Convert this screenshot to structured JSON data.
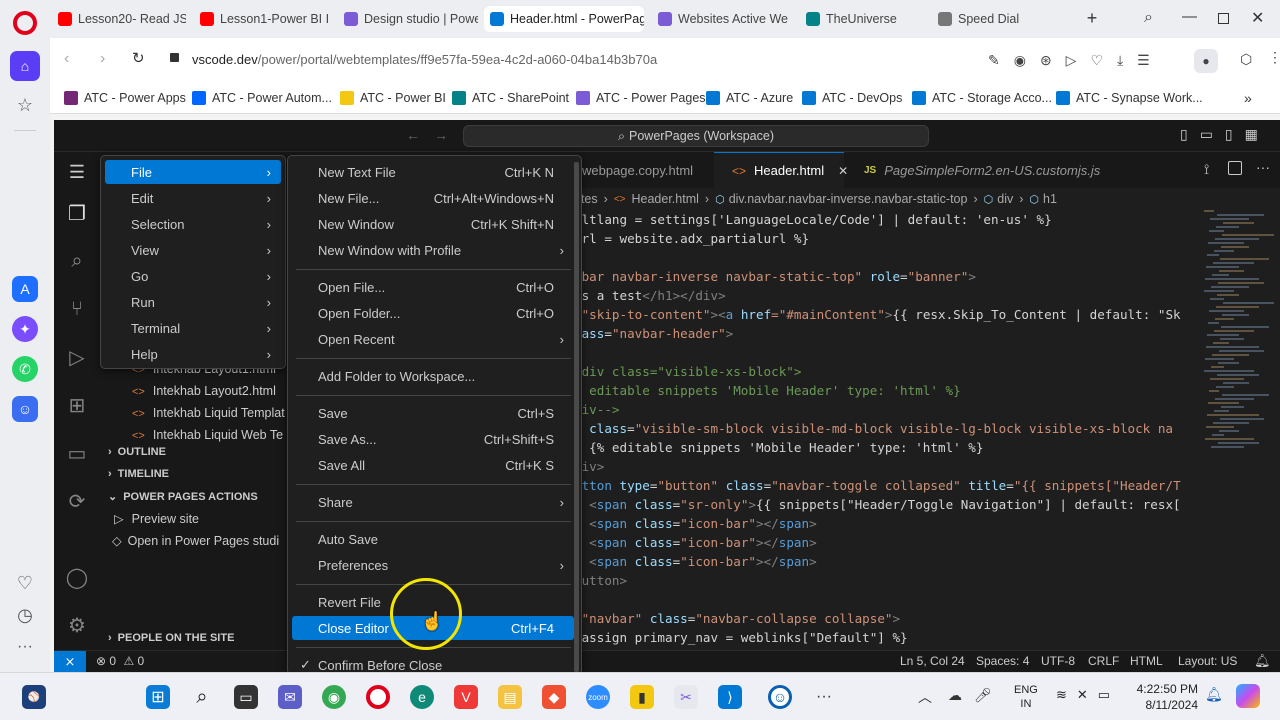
{
  "browser": {
    "tabs": [
      {
        "label": "Lesson20- Read JSO",
        "icon": "youtube-icon",
        "color": "#ff0000"
      },
      {
        "label": "Lesson1-Power BI In",
        "icon": "youtube-icon",
        "color": "#ff0000"
      },
      {
        "label": "Design studio | Powe",
        "icon": "power-pages-icon",
        "color": "#7b5cd6"
      },
      {
        "label": "Header.html - PowerPage",
        "icon": "vscode-icon",
        "color": "#0078d4"
      },
      {
        "label": "Websites Active We",
        "icon": "power-pages-icon",
        "color": "#7b5cd6"
      },
      {
        "label": "TheUniverse",
        "icon": "sharepoint-icon",
        "color": "#038387"
      },
      {
        "label": "Speed Dial",
        "icon": "grid-icon",
        "color": "#777777"
      }
    ],
    "url_prefix": "vscode.dev",
    "url_path": "/power/portal/webtemplates/ff9e57fa-59ea-4c2d-a060-04ba14b3b70a",
    "bookmarks": [
      {
        "label": "ATC - Power Apps",
        "color": "#742774"
      },
      {
        "label": "ATC - Power Autom...",
        "color": "#0066ff"
      },
      {
        "label": "ATC - Power BI",
        "color": "#f2c811"
      },
      {
        "label": "ATC - SharePoint",
        "color": "#038387"
      },
      {
        "label": "ATC - Power Pages",
        "color": "#7b5cd6"
      },
      {
        "label": "ATC - Azure",
        "color": "#0078d4"
      },
      {
        "label": "ATC - DevOps",
        "color": "#0078d4"
      },
      {
        "label": "ATC - Storage Acco...",
        "color": "#0078d4"
      },
      {
        "label": "ATC - Synapse Work...",
        "color": "#0078d4"
      }
    ]
  },
  "vscode": {
    "command_center": "PowerPages (Workspace)",
    "editor_tabs": [
      {
        "label": "webpage.copy.html",
        "active": false
      },
      {
        "label": "Header.html",
        "active": true,
        "close": "✕"
      },
      {
        "label": "PageSimpleForm2.en-US.customjs.js",
        "active": false,
        "prefix": "JS"
      }
    ],
    "breadcrumb": [
      "ates",
      "Header.html",
      "div.navbar.navbar-inverse.navbar-static-top",
      "div",
      "h1"
    ],
    "explorer_files": [
      "Intekhab Layout1.html",
      "Intekhab Layout2.html",
      "Intekhab Liquid Templat",
      "Intekhab Liquid Web Te"
    ],
    "sections": {
      "outline": "OUTLINE",
      "timeline": "TIMELINE",
      "power_pages_actions": "POWER PAGES ACTIONS",
      "preview_site": "Preview site",
      "open_in_power_pages": "Open in Power Pages studi",
      "people_on_site": "PEOPLE ON THE SITE"
    },
    "code_lines": [
      [
        [
          "ultlang = settings['LanguageLocale/Code'] | default: 'en-us' %}",
          "#d4d4d4"
        ]
      ],
      [
        [
          "url = website.adx_partialurl %}",
          "#d4d4d4"
        ]
      ],
      [
        [
          "",
          "#d4d4d4"
        ]
      ],
      [
        [
          "vbar navbar-inverse navbar-static-top\"",
          "#ce9178"
        ],
        [
          " role",
          "#9cdcfe"
        ],
        [
          "=",
          "#d4d4d4"
        ],
        [
          "\"banner\"",
          "#ce9178"
        ],
        [
          ">",
          "#808080"
        ]
      ],
      [
        [
          "is a test",
          "#d4d4d4"
        ],
        [
          "</h1></div>",
          "#808080"
        ]
      ],
      [
        [
          "=\"skip-to-content\"",
          "#ce9178"
        ],
        [
          "><",
          "#808080"
        ],
        [
          "a",
          "#569cd6"
        ],
        [
          " href",
          "#9cdcfe"
        ],
        [
          "=\"#mainContent\"",
          "#ce9178"
        ],
        [
          ">",
          "#808080"
        ],
        [
          "{{ resx.Skip_To_Content | default: \"Sk",
          "#d4d4d4"
        ]
      ],
      [
        [
          "lass",
          "#9cdcfe"
        ],
        [
          "=",
          "#d4d4d4"
        ],
        [
          "\"navbar-header\"",
          "#ce9178"
        ],
        [
          ">",
          "#808080"
        ]
      ],
      [
        [
          "",
          "#d4d4d4"
        ]
      ],
      [
        [
          "-div class=\"visible-xs-block\">",
          "#6a9955"
        ]
      ],
      [
        [
          "% editable snippets 'Mobile Header' type: 'html' %}",
          "#6a9955"
        ]
      ],
      [
        [
          "div-->",
          "#6a9955"
        ]
      ],
      [
        [
          "v",
          "#569cd6"
        ],
        [
          " class",
          "#9cdcfe"
        ],
        [
          "=",
          "#d4d4d4"
        ],
        [
          "\"visible-sm-block visible-md-block visible-lg-block visible-xs-block na",
          "#ce9178"
        ]
      ],
      [
        [
          "  {% editable snippets 'Mobile Header' type: 'html' %}",
          "#d4d4d4"
        ]
      ],
      [
        [
          "div>",
          "#808080"
        ]
      ],
      [
        [
          "utton",
          "#569cd6"
        ],
        [
          " type",
          "#9cdcfe"
        ],
        [
          "=",
          "#d4d4d4"
        ],
        [
          "\"button\"",
          "#ce9178"
        ],
        [
          " class",
          "#9cdcfe"
        ],
        [
          "=",
          "#d4d4d4"
        ],
        [
          "\"navbar-toggle collapsed\"",
          "#ce9178"
        ],
        [
          " title",
          "#9cdcfe"
        ],
        [
          "=",
          "#d4d4d4"
        ],
        [
          "\"{{ snippets[\"Header/T",
          "#ce9178"
        ]
      ],
      [
        [
          "  <",
          "#808080"
        ],
        [
          "span",
          "#569cd6"
        ],
        [
          " class",
          "#9cdcfe"
        ],
        [
          "=",
          "#d4d4d4"
        ],
        [
          "\"sr-only\"",
          "#ce9178"
        ],
        [
          ">",
          "#808080"
        ],
        [
          "{{ snippets[\"Header/Toggle Navigation\"] | default: resx[",
          "#d4d4d4"
        ]
      ],
      [
        [
          "  <",
          "#808080"
        ],
        [
          "span",
          "#569cd6"
        ],
        [
          " class",
          "#9cdcfe"
        ],
        [
          "=",
          "#d4d4d4"
        ],
        [
          "\"icon-bar\"",
          "#ce9178"
        ],
        [
          "></",
          "#808080"
        ],
        [
          "span",
          "#569cd6"
        ],
        [
          ">",
          "#808080"
        ]
      ],
      [
        [
          "  <",
          "#808080"
        ],
        [
          "span",
          "#569cd6"
        ],
        [
          " class",
          "#9cdcfe"
        ],
        [
          "=",
          "#d4d4d4"
        ],
        [
          "\"icon-bar\"",
          "#ce9178"
        ],
        [
          "></",
          "#808080"
        ],
        [
          "span",
          "#569cd6"
        ],
        [
          ">",
          "#808080"
        ]
      ],
      [
        [
          "  <",
          "#808080"
        ],
        [
          "span",
          "#569cd6"
        ],
        [
          " class",
          "#9cdcfe"
        ],
        [
          "=",
          "#d4d4d4"
        ],
        [
          "\"icon-bar\"",
          "#ce9178"
        ],
        [
          "></",
          "#808080"
        ],
        [
          "span",
          "#569cd6"
        ],
        [
          ">",
          "#808080"
        ]
      ],
      [
        [
          "button>",
          "#808080"
        ]
      ],
      [
        [
          "",
          "#d4d4d4"
        ]
      ],
      [
        [
          "=\"navbar\"",
          "#ce9178"
        ],
        [
          " class",
          "#9cdcfe"
        ],
        [
          "=",
          "#d4d4d4"
        ],
        [
          "\"navbar-collapse collapse\"",
          "#ce9178"
        ],
        [
          ">",
          "#808080"
        ]
      ],
      [
        [
          " assign primary_nav = weblinks[\"Default\"] %}",
          "#d4d4d4"
        ]
      ]
    ],
    "main_menu": [
      {
        "label": "File",
        "selected": true
      },
      {
        "label": "Edit"
      },
      {
        "label": "Selection"
      },
      {
        "label": "View"
      },
      {
        "label": "Go"
      },
      {
        "label": "Run"
      },
      {
        "label": "Terminal"
      },
      {
        "label": "Help"
      }
    ],
    "file_menu": [
      {
        "label": "New Text File",
        "shortcut": "Ctrl+K N"
      },
      {
        "label": "New File...",
        "shortcut": "Ctrl+Alt+Windows+N"
      },
      {
        "label": "New Window",
        "shortcut": "Ctrl+K Shift+N"
      },
      {
        "label": "New Window with Profile",
        "submenu": true
      },
      {
        "separator": true
      },
      {
        "label": "Open File...",
        "shortcut": "Ctrl+O"
      },
      {
        "label": "Open Folder...",
        "shortcut": "Ctrl+O"
      },
      {
        "label": "Open Recent",
        "submenu": true
      },
      {
        "separator": true
      },
      {
        "label": "Add Folder to Workspace..."
      },
      {
        "separator": true
      },
      {
        "label": "Save",
        "shortcut": "Ctrl+S"
      },
      {
        "label": "Save As...",
        "shortcut": "Ctrl+Shift+S"
      },
      {
        "label": "Save All",
        "shortcut": "Ctrl+K S"
      },
      {
        "separator": true
      },
      {
        "label": "Share",
        "submenu": true
      },
      {
        "separator": true
      },
      {
        "label": "Auto Save"
      },
      {
        "label": "Preferences",
        "submenu": true
      },
      {
        "separator": true
      },
      {
        "label": "Revert File"
      },
      {
        "label": "Close Editor",
        "shortcut": "Ctrl+F4",
        "selected": true
      },
      {
        "separator": true
      },
      {
        "label": "Confirm Before Close",
        "checked": true
      }
    ],
    "status": {
      "problems": "0",
      "warnings": "0",
      "position": "Ln 5, Col 24",
      "spaces": "Spaces: 4",
      "encoding": "UTF-8",
      "eol": "CRLF",
      "language": "HTML",
      "layout": "Layout: US"
    }
  },
  "taskbar": {
    "lang_line1": "ENG",
    "lang_line2": "IN",
    "time": "4:22:50 PM",
    "date": "8/11/2024"
  }
}
